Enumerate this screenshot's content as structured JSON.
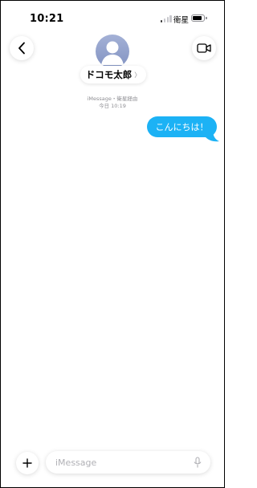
{
  "status_bar": {
    "time": "10:21",
    "carrier": "衛星",
    "signal_bars_active": 1,
    "signal_bars_total": 4
  },
  "header": {
    "contact_name": "ドコモ太郎",
    "name_chevron": "〉",
    "back_icon": "chevron-left-icon",
    "video_icon": "video-camera-icon"
  },
  "conversation": {
    "service_label": "iMessage・衛星経由",
    "timestamp": "今日 10:19",
    "messages": [
      {
        "sender": "me",
        "text": "こんにちは！"
      }
    ]
  },
  "composer": {
    "placeholder": "iMessage",
    "add_icon": "plus-icon",
    "mic_icon": "microphone-icon"
  },
  "colors": {
    "bubble": "#1cb2f5",
    "avatar_top": "#a4b1d6",
    "avatar_bottom": "#8293c2",
    "secondary_text": "#8e8e93"
  }
}
